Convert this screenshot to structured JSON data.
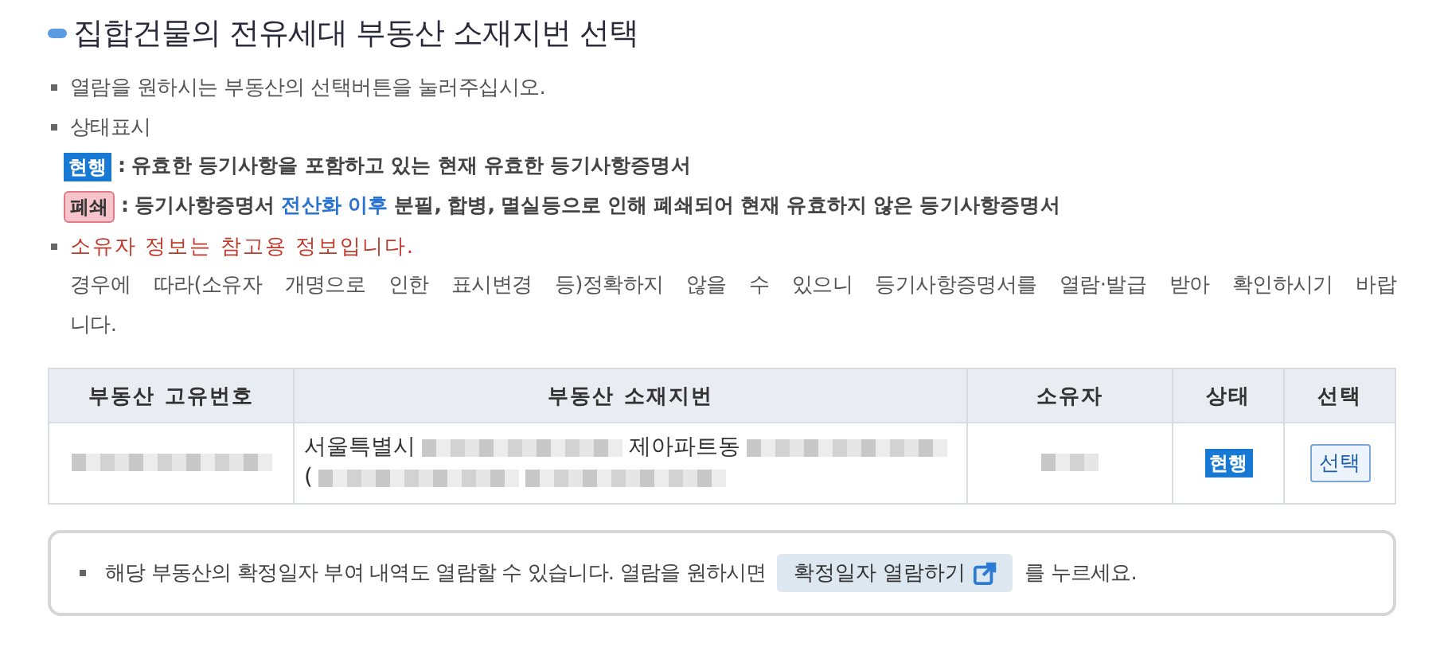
{
  "title": "집합건물의 전유세대 부동산 소재지번 선택",
  "notes": [
    {
      "kind": "plain",
      "text": "열람을 원하시는 부동산의 선택버튼을 눌러주십시오."
    },
    {
      "kind": "plain",
      "text": "상태표시"
    },
    {
      "kind": "legend",
      "badge": {
        "text": "현행",
        "kind": "current"
      },
      "text": ": 유효한 등기사항을 포함하고 있는 현재 유효한 등기사항증명서"
    },
    {
      "kind": "legend",
      "badge": {
        "text": "폐쇄",
        "kind": "closed"
      },
      "text": ": 등기사항증명서 **전산화 이후** 분필, 합병, 멸실등으로 인해 폐쇄되어 현재 유효하지 않은 등기사항증명서"
    },
    {
      "kind": "warning",
      "text": "소유자 정보는 참고용 정보입니다."
    },
    {
      "kind": "paragraph",
      "text": "경우에 따라(소유자 개명으로 인한 표시변경 등)정확하지 않을 수 있으니 등기사항증명서를 열람·발급 받아 확인하시기 바랍니다."
    }
  ],
  "table": {
    "columns": [
      "부동산 고유번호",
      "부동산 소재지번",
      "소유자",
      "상태",
      "선택"
    ],
    "rows": [
      {
        "cells": [
          {
            "kind": "redacted"
          },
          {
            "kind": "address",
            "parts": [
              {
                "kind": "text",
                "text": "서울특별시"
              },
              {
                "kind": "redacted"
              },
              {
                "kind": "text",
                "text": "제아파트동"
              },
              {
                "kind": "redacted"
              },
              {
                "kind": "break"
              },
              {
                "kind": "text",
                "text": "("
              },
              {
                "kind": "redacted"
              },
              {
                "kind": "redacted"
              }
            ]
          },
          {
            "kind": "redacted"
          },
          {
            "kind": "status",
            "badge": {
              "text": "현행",
              "kind": "current"
            }
          },
          {
            "kind": "button",
            "text": "선택"
          }
        ]
      }
    ]
  },
  "footer": {
    "text_before": "해당 부동산의 확정일자 부여 내역도 열람할 수 있습니다. 열람을 원하시면",
    "button": "확정일자 열람하기",
    "text_after": "를 누르세요."
  }
}
